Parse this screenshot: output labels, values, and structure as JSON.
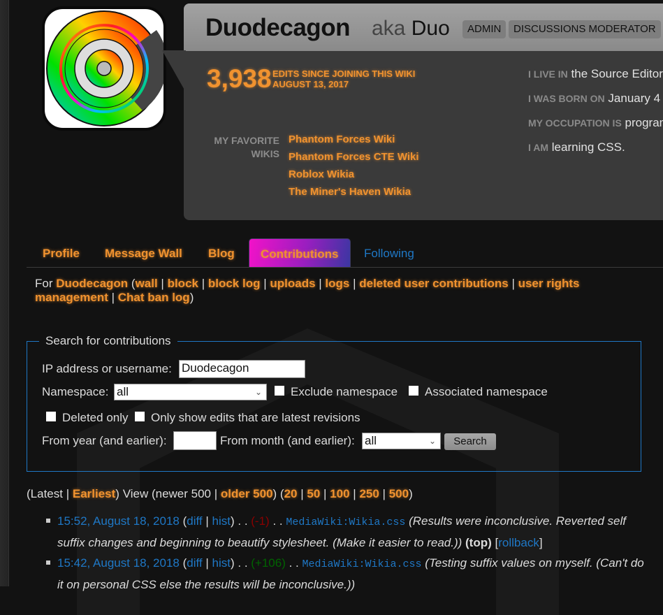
{
  "profile": {
    "username": "Duodecagon",
    "aka_label": "aka",
    "nickname": "Duo",
    "tags": [
      "ADMIN",
      "DISCUSSIONS MODERATOR"
    ],
    "edit_count": "3,938",
    "edit_desc_line1": "EDITS SINCE JOINING THIS WIKI",
    "edit_desc_line2": "AUGUST 13, 2017",
    "favorite_label_line1": "MY FAVORITE",
    "favorite_label_line2": "WIKIS",
    "favorite_wikis": [
      "Phantom Forces Wiki",
      "Phantom Forces CTE Wiki",
      "Roblox Wikia",
      "The Miner's Haven Wikia"
    ],
    "details": [
      {
        "label": "I LIVE IN",
        "value": "the Source Editor"
      },
      {
        "label": "I WAS BORN ON",
        "value": "January 4"
      },
      {
        "label": "MY OCCUPATION IS",
        "value": "programming"
      },
      {
        "label": "I AM",
        "value": "learning CSS."
      }
    ]
  },
  "tabs": [
    {
      "label": "Profile"
    },
    {
      "label": "Message Wall"
    },
    {
      "label": "Blog"
    },
    {
      "label": "Contributions",
      "active": true
    },
    {
      "label": "Following"
    }
  ],
  "user_links": {
    "for_label": "For",
    "user": "Duodecagon",
    "links": [
      "wall",
      "block",
      "block log",
      "uploads",
      "logs",
      "deleted user contributions",
      "user rights management",
      "Chat ban log"
    ]
  },
  "search": {
    "legend": "Search for contributions",
    "username_label": "IP address or username:",
    "username_value": "Duodecagon",
    "namespace_label": "Namespace:",
    "namespace_value": "all",
    "exclude_namespace": "Exclude namespace",
    "associated_namespace": "Associated namespace",
    "deleted_only": "Deleted only",
    "latest_only": "Only show edits that are latest revisions",
    "year_label": "From year (and earlier):",
    "year_value": "",
    "month_label": "From month (and earlier):",
    "month_value": "all",
    "search_button": "Search"
  },
  "pager": {
    "latest": "Latest",
    "earliest": "Earliest",
    "view": "View",
    "newer": "newer 500",
    "older": "older 500",
    "limits": [
      "20",
      "50",
      "100",
      "250",
      "500"
    ]
  },
  "contributions": [
    {
      "time": "15:52, August 18, 2018",
      "diff": "diff",
      "hist": "hist",
      "size": "(-1)",
      "page": "MediaWiki:Wikia.css",
      "comment": "(Results were inconclusive. Reverted self suffix changes and beginning to beautify stylesheet. (Make it easier to read.))",
      "top": "(top)",
      "rollback": "rollback"
    },
    {
      "time": "15:42, August 18, 2018",
      "diff": "diff",
      "hist": "hist",
      "size": "(+106)",
      "page": "MediaWiki:Wikia.css",
      "comment": "(Testing suffix values on myself. (Can't do it on personal CSS else the results will be inconclusive.))"
    }
  ]
}
